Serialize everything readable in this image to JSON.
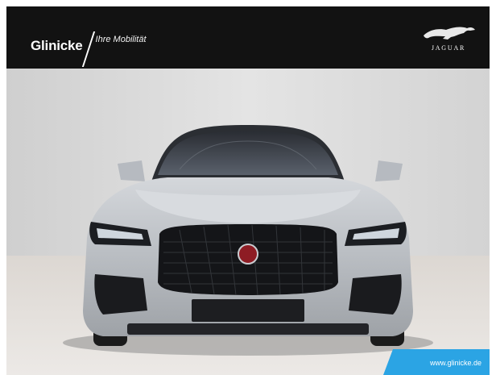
{
  "header": {
    "brand_name": "Glinicke",
    "brand_tagline": "Ihre Mobilität",
    "partner_logo_text": "JAGUAR"
  },
  "photo": {
    "badge_url": "www.glinicke.de"
  },
  "colors": {
    "header_bg": "#121212",
    "badge_bg": "#2ba4e4",
    "car_body": "#c3c7cc"
  }
}
